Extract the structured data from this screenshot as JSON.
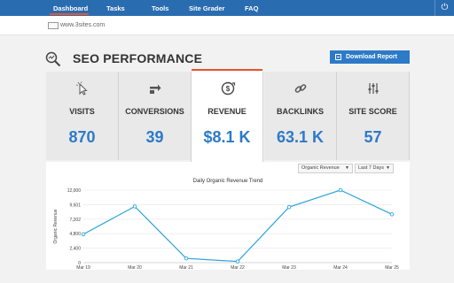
{
  "nav": {
    "items": [
      {
        "label": "Dashboard",
        "active": true
      },
      {
        "label": "Tasks",
        "active": false
      },
      {
        "label": "Tools",
        "active": false
      },
      {
        "label": "Site Grader",
        "active": false
      },
      {
        "label": "FAQ",
        "active": false
      }
    ],
    "power_icon": "power-icon"
  },
  "site": {
    "url": "www.3sites.com"
  },
  "page": {
    "title": "SEO PERFORMANCE",
    "download_label": "Download Report"
  },
  "metrics": [
    {
      "label": "VISITS",
      "value": "870",
      "icon": "cursor-click-icon"
    },
    {
      "label": "CONVERSIONS",
      "value": "39",
      "icon": "exchange-icon"
    },
    {
      "label": "REVENUE",
      "value": "$8.1 K",
      "icon": "revenue-icon",
      "active": true
    },
    {
      "label": "BACKLINKS",
      "value": "63.1 K",
      "icon": "link-icon"
    },
    {
      "label": "SITE SCORE",
      "value": "57",
      "icon": "sliders-icon"
    }
  ],
  "chart_controls": {
    "metric_select": "Organic Revenue",
    "range_select": "Last 7 Days"
  },
  "colors": {
    "accent": "#2d7ac7",
    "nav": "#2a6cb0",
    "highlight": "#e8542a",
    "line": "#29a3d9"
  },
  "chart_data": {
    "type": "line",
    "title": "Daily Organic Revenue Trend",
    "ylabel": "Organic Revenue",
    "xlabel": "",
    "categories": [
      "Mar 19",
      "Mar 20",
      "Mar 21",
      "Mar 22",
      "Mar 23",
      "Mar 24",
      "Mar 25"
    ],
    "series": [
      {
        "values": [
          4700,
          9300,
          700,
          200,
          9200,
          12000,
          8000
        ]
      }
    ],
    "y_ticks": [
      "0",
      "2,400",
      "4,800",
      "7,202",
      "9,601",
      "12,000"
    ],
    "ylim": [
      0,
      12000
    ],
    "grid": true
  }
}
